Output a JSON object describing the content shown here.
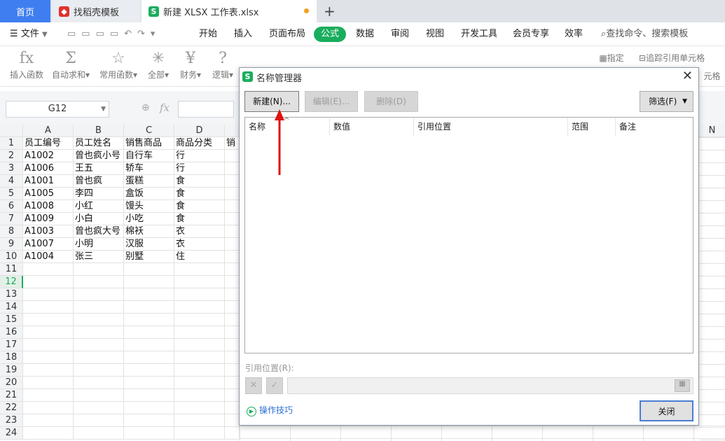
{
  "tabs": {
    "home": "首页",
    "template": "找稻壳模板",
    "file": "新建 XLSX 工作表.xlsx",
    "add": "+"
  },
  "menu": {
    "file": "文件",
    "items": [
      "开始",
      "插入",
      "页面布局",
      "公式",
      "数据",
      "审阅",
      "视图",
      "开发工具",
      "会员专享",
      "效率"
    ],
    "search": "查找命令、搜索模板"
  },
  "ribbon": {
    "items": [
      "插入函数",
      "自动求和",
      "常用函数",
      "全部",
      "财务",
      "逻辑"
    ],
    "right": [
      "指定",
      "追踪引用单元格",
      "元格"
    ]
  },
  "formula": {
    "namebox": "G12",
    "fx": "fx"
  },
  "grid": {
    "columns": [
      "A",
      "B",
      "C",
      "D"
    ],
    "header": [
      "员工编号",
      "员工姓名",
      "销售商品",
      "商品分类",
      "销"
    ],
    "rows": [
      [
        "A1002",
        "曾也疯小号",
        "自行车",
        "行"
      ],
      [
        "A1006",
        "王五",
        "轿车",
        "行"
      ],
      [
        "A1001",
        "曾也疯",
        "蛋糕",
        "食"
      ],
      [
        "A1005",
        "李四",
        "盒饭",
        "食"
      ],
      [
        "A1008",
        "小红",
        "馒头",
        "食"
      ],
      [
        "A1009",
        "小白",
        "小吃",
        "食"
      ],
      [
        "A1003",
        "曾也疯大号",
        "棉袄",
        "衣"
      ],
      [
        "A1007",
        "小明",
        "汉服",
        "衣"
      ],
      [
        "A1004",
        "张三",
        "别墅",
        "住"
      ]
    ],
    "row_numbers": [
      "1",
      "2",
      "3",
      "4",
      "5",
      "6",
      "7",
      "8",
      "9",
      "10",
      "11",
      "12",
      "13",
      "14",
      "15",
      "16",
      "17",
      "18",
      "19",
      "20",
      "21",
      "22",
      "23",
      "24"
    ],
    "col_n": "N"
  },
  "dialog": {
    "title": "名称管理器",
    "new": "新建(N)...",
    "edit": "编辑(E)...",
    "delete": "删除(D)",
    "filter": "筛选(F)",
    "columns": [
      "名称",
      "数值",
      "引用位置",
      "范围",
      "备注"
    ],
    "ref_label": "引用位置(R):",
    "tips": "操作技巧",
    "close": "关闭"
  },
  "colors": {
    "accent": "#1aad5d",
    "home_tab": "#3f7ef0",
    "arrow": "#e01010"
  }
}
